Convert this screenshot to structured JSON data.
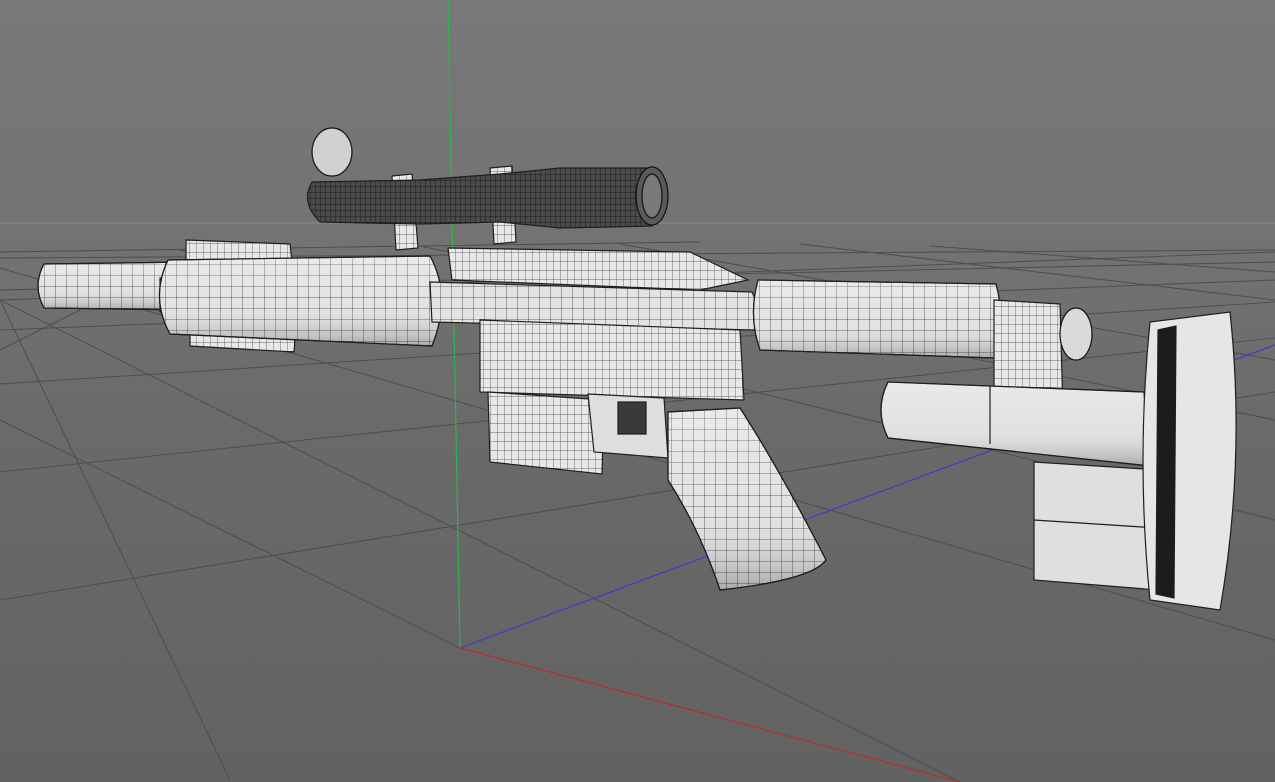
{
  "viewport": {
    "view": "perspective",
    "scene_object": "rifle-model",
    "display_mode": "wireframe-shaded",
    "axis_colors": {
      "x": "#c0282a",
      "y": "#2fb34a",
      "z": "#3a3ec4"
    },
    "background": "#707070",
    "grid_color": "#4c4c4c",
    "model_color": "#e4e4e4",
    "wire_color": "#2a2a2a"
  }
}
